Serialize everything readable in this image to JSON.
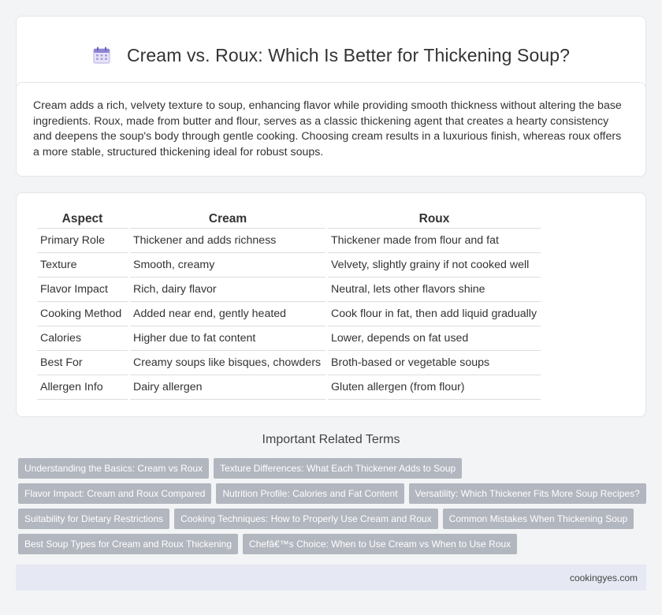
{
  "header": {
    "title": "Cream vs. Roux: Which Is Better for Thickening Soup?",
    "icon": "calendar-icon"
  },
  "intro": {
    "text": "Cream adds a rich, velvety texture to soup, enhancing flavor while providing smooth thickness without altering the base ingredients. Roux, made from butter and flour, serves as a classic thickening agent that creates a hearty consistency and deepens the soup's body through gentle cooking. Choosing cream results in a luxurious finish, whereas roux offers a more stable, structured thickening ideal for robust soups."
  },
  "table": {
    "headers": [
      "Aspect",
      "Cream",
      "Roux"
    ],
    "rows": [
      [
        "Primary Role",
        "Thickener and adds richness",
        "Thickener made from flour and fat"
      ],
      [
        "Texture",
        "Smooth, creamy",
        "Velvety, slightly grainy if not cooked well"
      ],
      [
        "Flavor Impact",
        "Rich, dairy flavor",
        "Neutral, lets other flavors shine"
      ],
      [
        "Cooking Method",
        "Added near end, gently heated",
        "Cook flour in fat, then add liquid gradually"
      ],
      [
        "Calories",
        "Higher due to fat content",
        "Lower, depends on fat used"
      ],
      [
        "Best For",
        "Creamy soups like bisques, chowders",
        "Broth-based or vegetable soups"
      ],
      [
        "Allergen Info",
        "Dairy allergen",
        "Gluten allergen (from flour)"
      ]
    ]
  },
  "related": {
    "heading": "Important Related Terms",
    "tags": [
      "Understanding the Basics: Cream vs Roux",
      "Texture Differences: What Each Thickener Adds to Soup",
      "Flavor Impact: Cream and Roux Compared",
      "Nutrition Profile: Calories and Fat Content",
      "Versatility: Which Thickener Fits More Soup Recipes?",
      "Suitability for Dietary Restrictions",
      "Cooking Techniques: How to Properly Use Cream and Roux",
      "Common Mistakes When Thickening Soup",
      "Best Soup Types for Cream and Roux Thickening",
      "Chefâ€™s Choice: When to Use Cream vs When to Use Roux"
    ]
  },
  "footer": {
    "site": "cookingyes.com"
  }
}
